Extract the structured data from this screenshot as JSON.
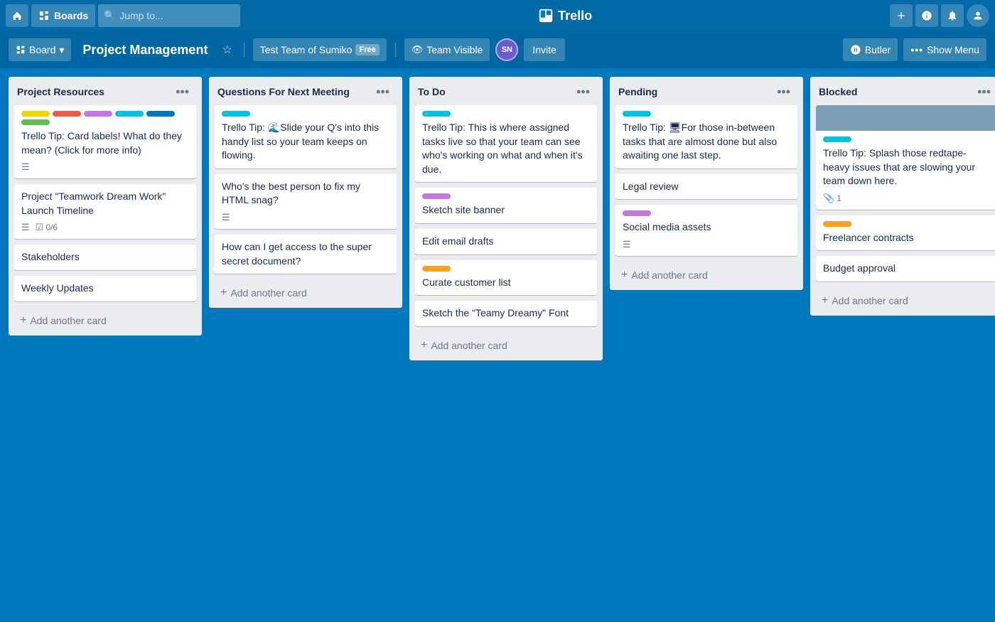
{
  "nav": {
    "boards_label": "Boards",
    "search_placeholder": "Jump to...",
    "trello_label": "Trello",
    "plus_title": "Create",
    "info_title": "Information",
    "bell_title": "Notifications",
    "user_title": "Account"
  },
  "board_header": {
    "title": "Project Management",
    "team_name": "Test Team of Sumiko",
    "team_badge": "Free",
    "team_visible_label": "Team Visible",
    "invite_label": "Invite",
    "butler_label": "Butler",
    "show_menu_label": "Show Menu",
    "avatar_initials": "SN"
  },
  "lists": [
    {
      "id": "project-resources",
      "title": "Project Resources",
      "cards": [
        {
          "id": "pr-tip",
          "labels": [
            "yellow",
            "red",
            "purple",
            "teal",
            "blue-label",
            "green"
          ],
          "text": "Trello Tip: Card labels! What do they mean? (Click for more info)",
          "footer_icons": [
            "description"
          ]
        },
        {
          "id": "pr-timeline",
          "text": "Project \"Teamwork Dream Work\" Launch Timeline",
          "footer_icons": [
            "description",
            "checklist"
          ],
          "checklist_text": "0/6"
        },
        {
          "id": "pr-stakeholders",
          "text": "Stakeholders"
        },
        {
          "id": "pr-weekly",
          "text": "Weekly Updates"
        }
      ],
      "add_card_label": "Add another card"
    },
    {
      "id": "questions-next-meeting",
      "title": "Questions For Next Meeting",
      "cards": [
        {
          "id": "qnm-tip",
          "labels": [
            "teal"
          ],
          "text": "Trello Tip: 🌊Slide your Q's into this handy list so your team keeps on flowing."
        },
        {
          "id": "qnm-html",
          "text": "Who's the best person to fix my HTML snag?",
          "footer_icons": [
            "description"
          ]
        },
        {
          "id": "qnm-doc",
          "text": "How can I get access to the super secret document?"
        }
      ],
      "add_card_label": "Add another card"
    },
    {
      "id": "to-do",
      "title": "To Do",
      "cards": [
        {
          "id": "td-tip",
          "labels": [
            "teal"
          ],
          "text": "Trello Tip: This is where assigned tasks live so that your team can see who's working on what and when it's due."
        },
        {
          "id": "td-sketch",
          "labels": [
            "purple"
          ],
          "text": "Sketch site banner"
        },
        {
          "id": "td-email",
          "text": "Edit email drafts"
        },
        {
          "id": "td-curate",
          "labels": [
            "orange"
          ],
          "text": "Curate customer list"
        },
        {
          "id": "td-font",
          "text": "Sketch the \"Teamy Dreamy\" Font"
        }
      ],
      "add_card_label": "Add another card"
    },
    {
      "id": "pending",
      "title": "Pending",
      "cards": [
        {
          "id": "pe-tip",
          "labels": [
            "teal"
          ],
          "text": "Trello Tip: 🖥For those in-between tasks that are almost done but also awaiting one last step."
        },
        {
          "id": "pe-legal",
          "text": "Legal review"
        },
        {
          "id": "pe-social",
          "labels": [
            "purple"
          ],
          "text": "Social media assets",
          "footer_icons": [
            "description"
          ]
        }
      ],
      "add_card_label": "Add another card"
    },
    {
      "id": "blocked",
      "title": "Blocked",
      "cards": [
        {
          "id": "bl-cover",
          "has_cover": true,
          "labels": [
            "teal"
          ],
          "text": "Trello Tip: Splash those redtape-heavy issues that are slowing your team down here.",
          "attachment_count": "1"
        },
        {
          "id": "bl-freelancer",
          "labels": [
            "orange"
          ],
          "text": "Freelancer contracts"
        },
        {
          "id": "bl-budget",
          "text": "Budget approval"
        }
      ],
      "add_card_label": "Add another card"
    }
  ]
}
